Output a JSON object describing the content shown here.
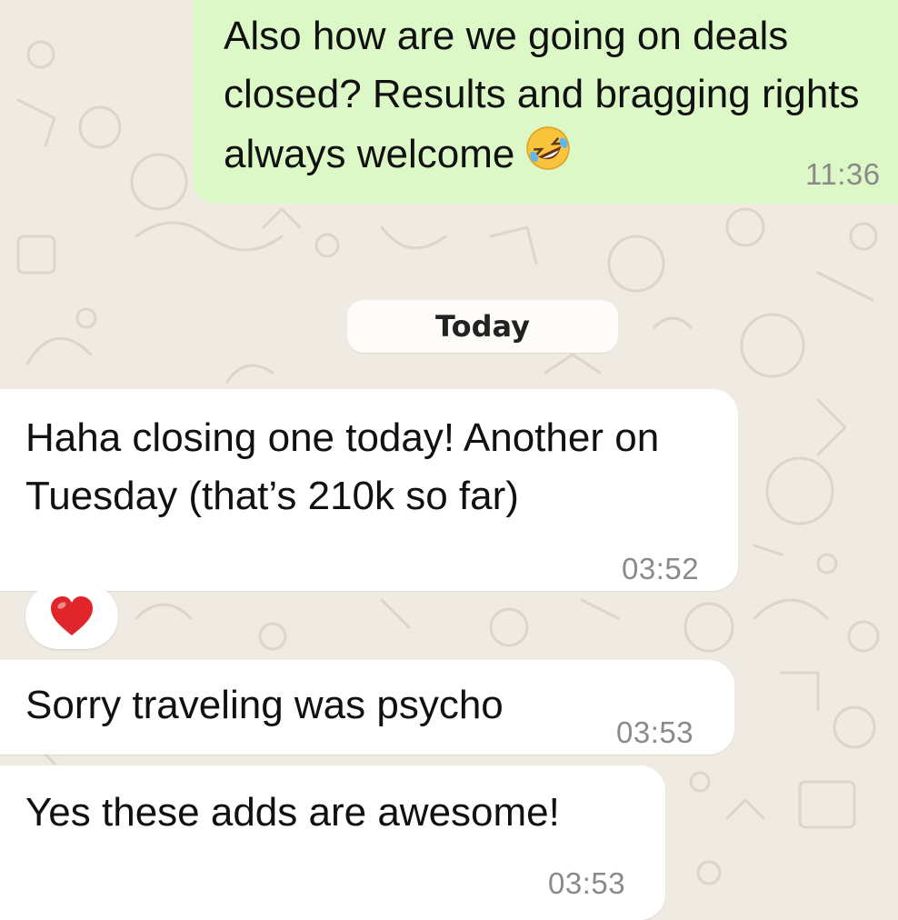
{
  "messages": {
    "outgoing": {
      "text": "Also how are we going on deals closed? Results and bragging rights always welcome",
      "emoji": "rolling-on-the-floor-laughing",
      "time": "11:36"
    },
    "date_divider": "Today",
    "incoming": [
      {
        "text": "Haha closing one today! Another on Tuesday (that’s 210k so far)",
        "time": "03:52",
        "reaction": "red-heart"
      },
      {
        "text": "Sorry traveling was psycho",
        "time": "03:53"
      },
      {
        "text": "Yes these adds are awesome!",
        "time": "03:53"
      }
    ]
  },
  "colors": {
    "background": "#efeae2",
    "outgoing_bubble": "#dcf8c6",
    "incoming_bubble": "#ffffff",
    "timestamp": "#8a8a8a",
    "heart": "#e0262b"
  }
}
